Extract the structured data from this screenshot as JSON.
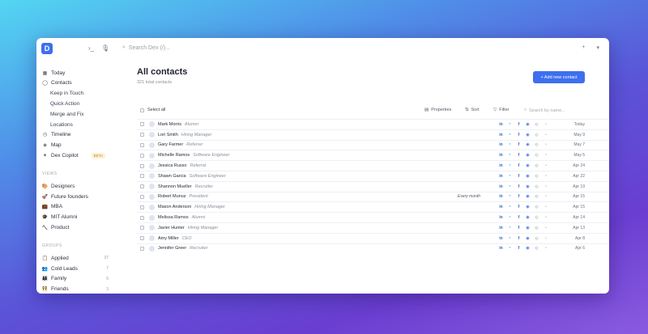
{
  "topbar": {
    "logo": "D",
    "search_placeholder": "Search Dex (/)..."
  },
  "sidebar": {
    "main_items": [
      {
        "label": "Today",
        "icon": "calendar-icon"
      },
      {
        "label": "Contacts",
        "icon": "person-icon"
      },
      {
        "label": "Keep in Touch"
      },
      {
        "label": "Quick Action"
      },
      {
        "label": "Merge and Fix"
      },
      {
        "label": "Locations"
      },
      {
        "label": "Timeline",
        "icon": "clock-icon"
      },
      {
        "label": "Map",
        "icon": "map-icon"
      },
      {
        "label": "Dex Copilot",
        "icon": "sparkle-icon",
        "badge": "BETA"
      }
    ],
    "views_heading": "VIEWS",
    "views": [
      {
        "label": "Designers",
        "icon": "🎨"
      },
      {
        "label": "Future founders",
        "icon": "🚀"
      },
      {
        "label": "MBA",
        "icon": "💼"
      },
      {
        "label": "MIT Alumni",
        "icon": "🎓"
      },
      {
        "label": "Product",
        "icon": "🔨"
      }
    ],
    "groups_heading": "GROUPS",
    "groups": [
      {
        "label": "Applied",
        "icon": "📋",
        "count": "37"
      },
      {
        "label": "Cold Leads",
        "icon": "👥",
        "count": "7"
      },
      {
        "label": "Family",
        "icon": "👨‍👩‍👧",
        "count": "5"
      },
      {
        "label": "Friends",
        "icon": "👯",
        "count": "3"
      }
    ]
  },
  "main": {
    "title": "All contacts",
    "subtitle": "321 total contacts",
    "add_button": "+ Add new contact",
    "select_all": "Select all",
    "properties": "Properties",
    "sort": "Sort",
    "filter": "Filter",
    "search_placeholder": "Search by name..."
  },
  "contacts": [
    {
      "name": "Mark Morris",
      "role": "Alumni",
      "date": "Today"
    },
    {
      "name": "Lori Smith",
      "role": "Hiring Manager",
      "date": "May 9"
    },
    {
      "name": "Gary Farmer",
      "role": "Referrer",
      "date": "May 7"
    },
    {
      "name": "Michelle Ramos",
      "role": "Software Engineer",
      "date": "May 5"
    },
    {
      "name": "Jessica Russo",
      "role": "Referral",
      "date": "Apr 24"
    },
    {
      "name": "Shawn Garcia",
      "role": "Software Engineer",
      "date": "Apr 22"
    },
    {
      "name": "Shannon Mueller",
      "role": "Recruiter",
      "date": "Apr 19"
    },
    {
      "name": "Robert Munoz",
      "role": "President",
      "note": "Every month",
      "date": "Apr 15"
    },
    {
      "name": "Mason Anderson",
      "role": "Hiring Manager",
      "date": "Apr 15"
    },
    {
      "name": "Melissa Ramos",
      "role": "Alumni",
      "date": "Apr 14"
    },
    {
      "name": "Javier Hunter",
      "role": "Hiring Manager",
      "date": "Apr 13"
    },
    {
      "name": "Amy Miller",
      "role": "CEO",
      "date": "Apr 8"
    },
    {
      "name": "Jennifer Greer",
      "role": "Recruiter",
      "date": "Apr 6"
    }
  ],
  "colors": {
    "accent": "#3d6ff0",
    "linkedin": "#2a6bc4",
    "twitter": "#3aa0ea",
    "facebook": "#3b5fb8"
  }
}
